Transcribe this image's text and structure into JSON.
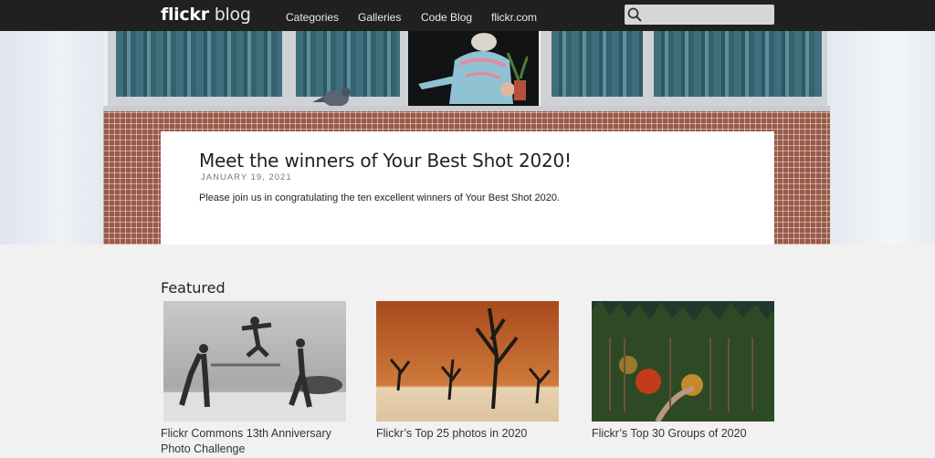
{
  "nav": {
    "logo_brand": "flickr",
    "logo_section": "blog",
    "links": [
      "Categories",
      "Galleries",
      "Code Blog",
      "flickr.com"
    ],
    "search_icon": "search-icon"
  },
  "hero": {
    "title": "Meet the winners of Your Best Shot 2020!",
    "date": "JANUARY 19, 2021",
    "excerpt": "Please join us in congratulating the ten excellent winners of Your Best Shot 2020."
  },
  "featured": {
    "heading": "Featured",
    "items": [
      {
        "caption_line1": "Flickr Commons 13th Anniversary",
        "caption_line2": "Photo Challenge"
      },
      {
        "caption_line1": "Flickr’s Top 25 photos in 2020",
        "caption_line2": ""
      },
      {
        "caption_line1": "Flickr’s Top 30 Groups of 2020",
        "caption_line2": ""
      }
    ]
  },
  "colors": {
    "topbar": "#202020",
    "brick": "#9a5a48",
    "page_bg": "#f1f1f1"
  }
}
